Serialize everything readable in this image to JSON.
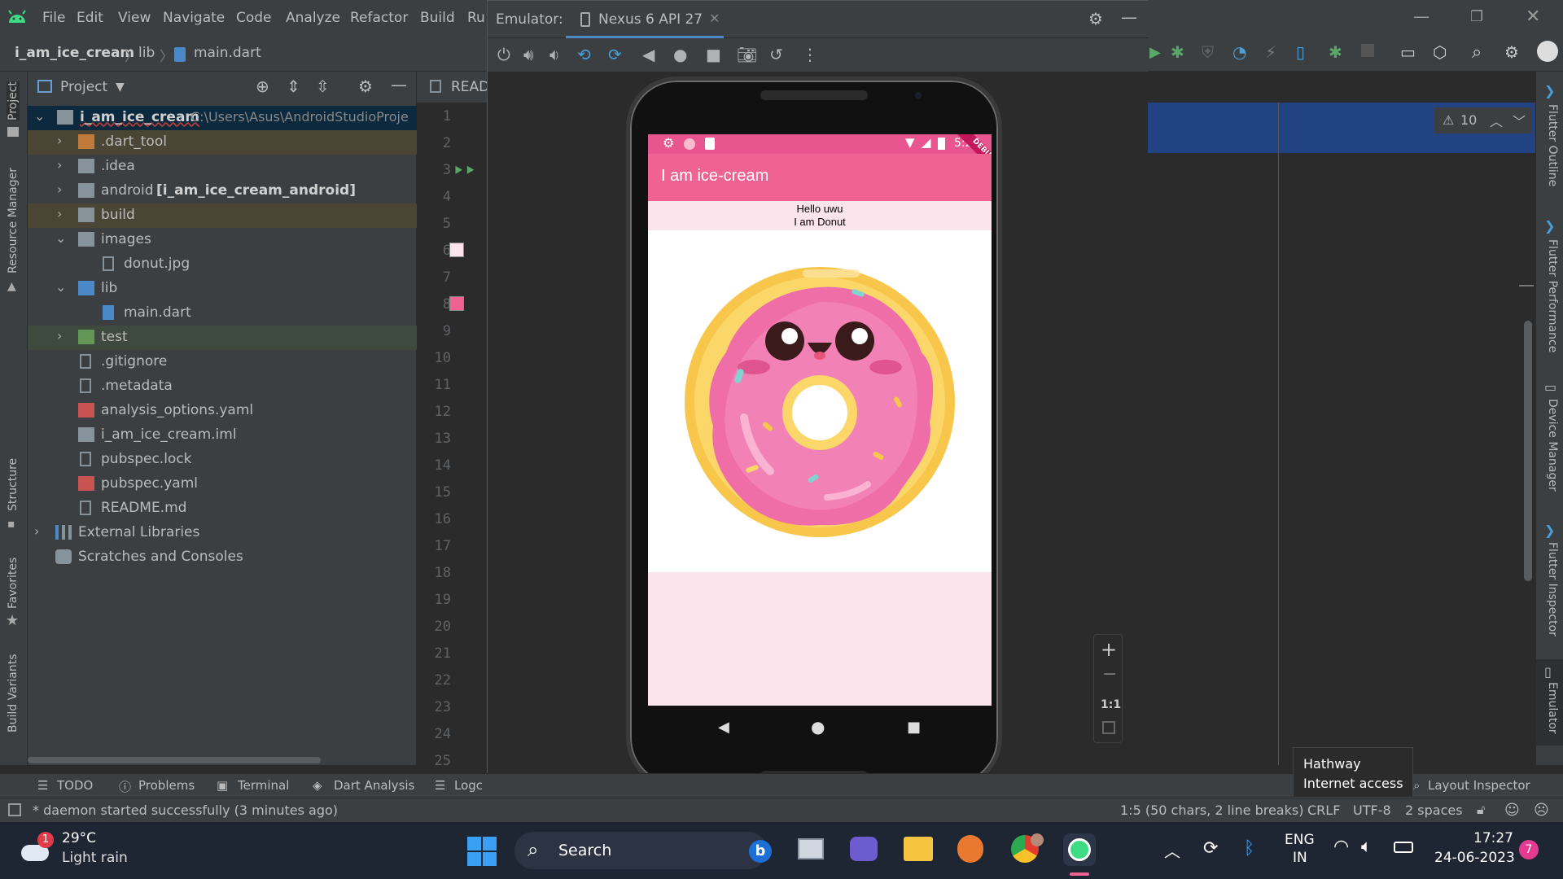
{
  "menubar": {
    "items": [
      "File",
      "Edit",
      "View",
      "Navigate",
      "Code",
      "Analyze",
      "Refactor",
      "Build",
      "Ru"
    ],
    "underlined": [
      "F",
      "E",
      "V",
      "N",
      "C",
      "z",
      "R",
      "B",
      "u"
    ]
  },
  "breadcrumb": {
    "project": "i_am_ice_cream",
    "folder": "lib",
    "file": "main.dart"
  },
  "project_panel": {
    "title": "Project",
    "root_name": "i_am_ice_cream",
    "root_path": "C:\\Users\\Asus\\AndroidStudioProje",
    "items": [
      {
        "label": ".dart_tool"
      },
      {
        "label": ".idea"
      },
      {
        "label": "android",
        "suffix": "[i_am_ice_cream_android]"
      },
      {
        "label": "build"
      },
      {
        "label": "images"
      },
      {
        "label": "donut.jpg"
      },
      {
        "label": "lib"
      },
      {
        "label": "main.dart"
      },
      {
        "label": "test"
      },
      {
        "label": ".gitignore"
      },
      {
        "label": ".metadata"
      },
      {
        "label": "analysis_options.yaml"
      },
      {
        "label": "i_am_ice_cream.iml"
      },
      {
        "label": "pubspec.lock"
      },
      {
        "label": "pubspec.yaml"
      },
      {
        "label": "README.md"
      },
      {
        "label": "External Libraries"
      },
      {
        "label": "Scratches and Consoles"
      }
    ]
  },
  "left_stripe": {
    "project": "Project",
    "resource_manager": "Resource Manager",
    "structure": "Structure",
    "favorites": "Favorites",
    "build_variants": "Build Variants"
  },
  "editor": {
    "tab_label": "READ",
    "line_numbers": [
      "1",
      "2",
      "3",
      "4",
      "5",
      "6",
      "7",
      "8",
      "9",
      "10",
      "11",
      "12",
      "13",
      "14",
      "15",
      "16",
      "17",
      "18",
      "19",
      "20",
      "21",
      "22",
      "23",
      "24",
      "25"
    ],
    "swatch_colors": {
      "line6": "#fce4ec",
      "line8": "#f06292"
    }
  },
  "emulator": {
    "label": "Emulator:",
    "device_tab": "Nexus 6 API 27",
    "zoom_ratio": "1:1"
  },
  "phone": {
    "time": "5:27",
    "debug_banner": "DEBUG",
    "app_title": "I am ice-cream",
    "line1": "Hello uwu",
    "line2": "I am Donut",
    "colors": {
      "appbar": "#f06292",
      "statusbar": "#e8558f",
      "background": "#fce4ec"
    }
  },
  "inspections": {
    "warnings": "10"
  },
  "right_stripe": {
    "outline": "Flutter Outline",
    "performance": "Flutter Performance",
    "device_manager": "Device Manager",
    "inspector": "Flutter Inspector",
    "emulator": "Emulator"
  },
  "bottom_tools": {
    "todo": "TODO",
    "problems": "Problems",
    "terminal": "Terminal",
    "dart_analysis": "Dart Analysis",
    "logcat": "Logc",
    "layout_inspector": "Layout Inspector"
  },
  "status": {
    "message": "* daemon started successfully (3 minutes ago)",
    "position": "1:5 (50 chars, 2 line breaks)",
    "line_sep": "CRLF",
    "encoding": "UTF-8",
    "indent": "2 spaces"
  },
  "wifi_tooltip": {
    "line1": "Hathway",
    "line2": "Internet access"
  },
  "taskbar": {
    "weather_badge": "1",
    "temperature": "29°C",
    "weather": "Light rain",
    "search": "Search",
    "lang1": "ENG",
    "lang2": "IN",
    "time": "17:27",
    "date": "24-06-2023",
    "notif_count": "7"
  }
}
